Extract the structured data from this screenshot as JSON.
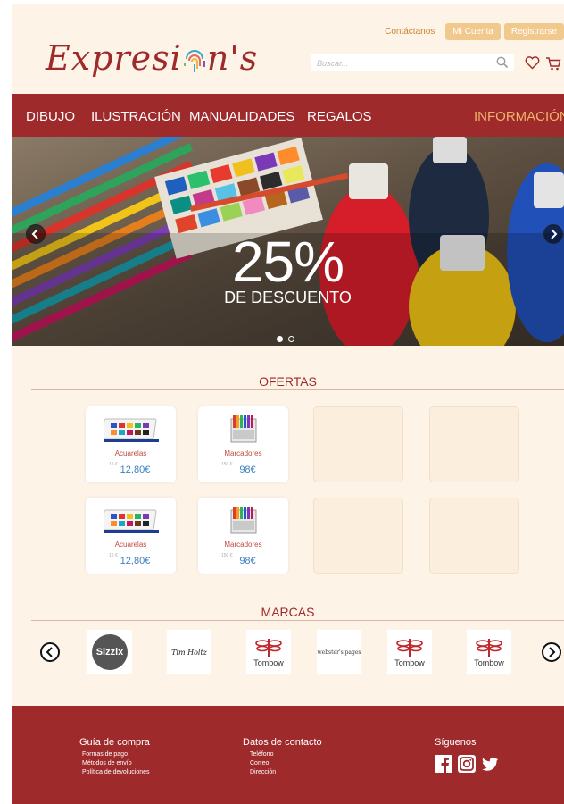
{
  "brand": {
    "logo_text": "Expresi",
    "logo_text_tail": "n's",
    "color": "#9e2a2b"
  },
  "header": {
    "contact_link": "Contáctanos",
    "account_button": "Mi Cuenta",
    "register_button": "Registrarse",
    "search_placeholder": "Buscar...",
    "icons": [
      "search-icon",
      "heart-icon",
      "cart-icon"
    ]
  },
  "nav": {
    "items": [
      "DIBUJO",
      "ILUSTRACIÓN",
      "MANUALIDADES",
      "REGALOS"
    ],
    "info": "INFORMACIÓN"
  },
  "hero": {
    "headline": "25%",
    "subline": "DE DESCUENTO",
    "slides": 2,
    "active_slide": 1
  },
  "offers": {
    "title": "OFERTAS",
    "products": [
      {
        "name": "Acuarelas",
        "old_price": "15 €",
        "price": "12,80€",
        "icon": "watercolor-set-icon"
      },
      {
        "name": "Marcadores",
        "old_price": "150 €",
        "price": "98€",
        "icon": "markers-icon"
      },
      {
        "name": "Acuarelas",
        "old_price": "15 €",
        "price": "12,80€",
        "icon": "watercolor-set-icon"
      },
      {
        "name": "Marcadores",
        "old_price": "150 €",
        "price": "98€",
        "icon": "markers-icon"
      }
    ]
  },
  "brands": {
    "title": "MARCAS",
    "items": [
      "Sizzix",
      "Tim Holtz",
      "Tombow",
      "webster's pages",
      "Tombow",
      "Tombow"
    ]
  },
  "footer": {
    "col1": {
      "title": "Guía de compra",
      "links": [
        "Formas de pago",
        "Métodos de envío",
        "Política de devoluciones"
      ]
    },
    "col2": {
      "title": "Datos de contacto",
      "links": [
        "Teléfono",
        "Correo",
        "Dirección"
      ]
    },
    "col3": {
      "title": "Síguenos",
      "icons": [
        "facebook-icon",
        "instagram-icon",
        "twitter-icon"
      ]
    }
  },
  "colors": {
    "accent": "#9e2a2b",
    "gold": "#f2c98d",
    "price": "#3a7fc2",
    "background": "#fdf3e6"
  }
}
